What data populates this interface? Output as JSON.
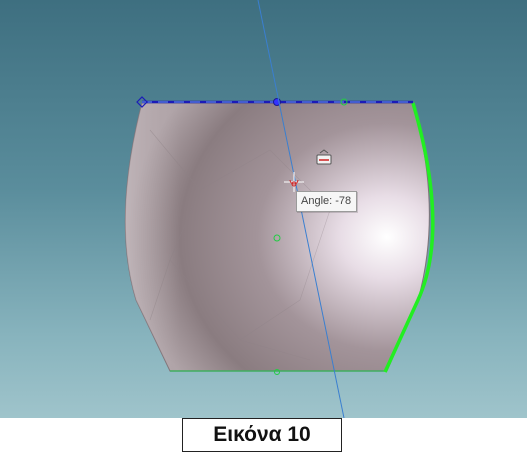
{
  "viewport": {
    "tooltip_text": "Angle: -78",
    "cursor_icon": "crosshair-cursor-icon",
    "tool_icon": "sketch-tool-icon",
    "colors": {
      "background_top": "#3e6f80",
      "background_bottom": "#9fc4cb",
      "part_surface": "#a8979c",
      "selected_edge": "#22ee22",
      "sketch_line": "#1b1bb8",
      "construction_line": "#3a7fd0"
    }
  },
  "caption": {
    "label": "Εικόνα 10"
  }
}
